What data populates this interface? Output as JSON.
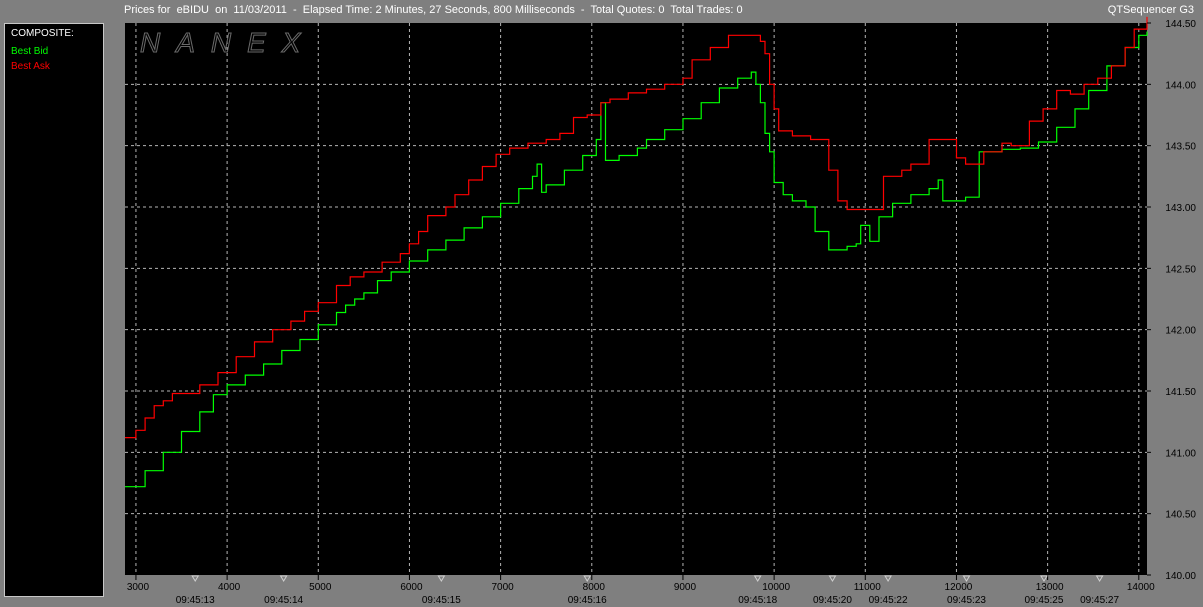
{
  "header": {
    "title": "Prices for  eBIDU  on  11/03/2011  -  Elapsed Time: 2 Minutes, 27 Seconds, 800 Milliseconds  -  Total Quotes: 0  Total Trades: 0",
    "app_name": "QTSequencer G3"
  },
  "legend": {
    "header": "COMPOSITE:",
    "items": [
      {
        "label": "Best Bid",
        "color": "#00ff00"
      },
      {
        "label": "Best Ask",
        "color": "#ff0000"
      }
    ]
  },
  "watermark": "NANEX",
  "colors": {
    "background": "#000000",
    "grid": "#b4b4b4",
    "frame": "#7f7f7f",
    "bid": "#00ff00",
    "ask": "#ff0000"
  },
  "chart_data": {
    "type": "line",
    "xlim": [
      2880,
      14090
    ],
    "ylim": [
      140.0,
      144.5
    ],
    "x_ticks": [
      3000,
      4000,
      5000,
      6000,
      7000,
      8000,
      9000,
      10000,
      11000,
      12000,
      13000,
      14000
    ],
    "x_tick_labels": [
      "3000",
      "4000",
      "5000",
      "6000",
      "7000",
      "8000",
      "9000",
      "10000",
      "11000",
      "12000",
      "13000",
      "14000"
    ],
    "y_ticks": [
      140.0,
      140.5,
      141.0,
      141.5,
      142.0,
      142.5,
      143.0,
      143.5,
      144.0,
      144.5
    ],
    "y_tick_labels": [
      "140.00",
      "140.50",
      "141.00",
      "141.50",
      "142.00",
      "142.50",
      "143.00",
      "143.50",
      "144.00",
      "144.50"
    ],
    "time_labels": [
      {
        "x": 3650,
        "label": "09:45:13"
      },
      {
        "x": 4620,
        "label": "09:45:14"
      },
      {
        "x": 6350,
        "label": "09:45:15"
      },
      {
        "x": 7950,
        "label": "09:45:16"
      },
      {
        "x": 9820,
        "label": "09:45:18"
      },
      {
        "x": 10640,
        "label": "09:45:20"
      },
      {
        "x": 11250,
        "label": "09:45:22"
      },
      {
        "x": 12110,
        "label": "09:45:23"
      },
      {
        "x": 12960,
        "label": "09:45:25"
      },
      {
        "x": 13570,
        "label": "09:45:27"
      }
    ],
    "grid": true,
    "series": [
      {
        "name": "Best Bid",
        "color": "#00ff00",
        "points": [
          [
            2880,
            140.72
          ],
          [
            3100,
            140.85
          ],
          [
            3300,
            141.0
          ],
          [
            3500,
            141.17
          ],
          [
            3700,
            141.33
          ],
          [
            3850,
            141.47
          ],
          [
            4000,
            141.55
          ],
          [
            4200,
            141.63
          ],
          [
            4400,
            141.72
          ],
          [
            4600,
            141.83
          ],
          [
            4800,
            141.92
          ],
          [
            5000,
            142.04
          ],
          [
            5200,
            142.14
          ],
          [
            5300,
            142.2
          ],
          [
            5400,
            142.25
          ],
          [
            5500,
            142.3
          ],
          [
            5650,
            142.4
          ],
          [
            5800,
            142.47
          ],
          [
            6000,
            142.56
          ],
          [
            6200,
            142.65
          ],
          [
            6400,
            142.73
          ],
          [
            6600,
            142.83
          ],
          [
            6800,
            142.92
          ],
          [
            7000,
            143.03
          ],
          [
            7200,
            143.15
          ],
          [
            7350,
            143.25
          ],
          [
            7400,
            143.35
          ],
          [
            7450,
            143.12
          ],
          [
            7500,
            143.18
          ],
          [
            7700,
            143.3
          ],
          [
            7900,
            143.42
          ],
          [
            8050,
            143.55
          ],
          [
            8100,
            143.85
          ],
          [
            8150,
            143.38
          ],
          [
            8300,
            143.42
          ],
          [
            8500,
            143.48
          ],
          [
            8600,
            143.55
          ],
          [
            8800,
            143.63
          ],
          [
            9000,
            143.72
          ],
          [
            9200,
            143.85
          ],
          [
            9400,
            143.97
          ],
          [
            9600,
            144.05
          ],
          [
            9750,
            144.1
          ],
          [
            9800,
            144.0
          ],
          [
            9850,
            143.85
          ],
          [
            9900,
            143.6
          ],
          [
            9950,
            143.45
          ],
          [
            10000,
            143.2
          ],
          [
            10100,
            143.1
          ],
          [
            10200,
            143.05
          ],
          [
            10350,
            143.0
          ],
          [
            10450,
            142.8
          ],
          [
            10600,
            142.65
          ],
          [
            10800,
            142.68
          ],
          [
            10900,
            142.7
          ],
          [
            10950,
            142.85
          ],
          [
            11050,
            142.72
          ],
          [
            11150,
            142.92
          ],
          [
            11300,
            143.03
          ],
          [
            11500,
            143.1
          ],
          [
            11700,
            143.15
          ],
          [
            11800,
            143.22
          ],
          [
            11850,
            143.05
          ],
          [
            12100,
            143.08
          ],
          [
            12250,
            143.45
          ],
          [
            12500,
            143.47
          ],
          [
            12700,
            143.48
          ],
          [
            12900,
            143.53
          ],
          [
            13100,
            143.65
          ],
          [
            13300,
            143.8
          ],
          [
            13450,
            143.95
          ],
          [
            13650,
            144.15
          ],
          [
            13850,
            144.3
          ],
          [
            14000,
            144.4
          ],
          [
            14090,
            144.43
          ]
        ]
      },
      {
        "name": "Best Ask",
        "color": "#ff0000",
        "points": [
          [
            2880,
            141.12
          ],
          [
            3000,
            141.18
          ],
          [
            3100,
            141.28
          ],
          [
            3200,
            141.38
          ],
          [
            3300,
            141.42
          ],
          [
            3400,
            141.48
          ],
          [
            3550,
            141.48
          ],
          [
            3700,
            141.55
          ],
          [
            3900,
            141.65
          ],
          [
            4100,
            141.78
          ],
          [
            4300,
            141.9
          ],
          [
            4500,
            142.0
          ],
          [
            4700,
            142.07
          ],
          [
            4850,
            142.15
          ],
          [
            5000,
            142.22
          ],
          [
            5200,
            142.36
          ],
          [
            5350,
            142.43
          ],
          [
            5500,
            142.47
          ],
          [
            5700,
            142.55
          ],
          [
            5900,
            142.62
          ],
          [
            6000,
            142.7
          ],
          [
            6100,
            142.8
          ],
          [
            6200,
            142.93
          ],
          [
            6400,
            143.0
          ],
          [
            6500,
            143.1
          ],
          [
            6650,
            143.22
          ],
          [
            6800,
            143.33
          ],
          [
            6950,
            143.43
          ],
          [
            7100,
            143.48
          ],
          [
            7300,
            143.52
          ],
          [
            7500,
            143.55
          ],
          [
            7650,
            143.6
          ],
          [
            7800,
            143.73
          ],
          [
            7950,
            143.75
          ],
          [
            8100,
            143.85
          ],
          [
            8200,
            143.88
          ],
          [
            8400,
            143.93
          ],
          [
            8600,
            143.96
          ],
          [
            8800,
            144.0
          ],
          [
            9000,
            144.05
          ],
          [
            9100,
            144.2
          ],
          [
            9300,
            144.3
          ],
          [
            9500,
            144.4
          ],
          [
            9700,
            144.4
          ],
          [
            9850,
            144.35
          ],
          [
            9900,
            144.25
          ],
          [
            9950,
            144.0
          ],
          [
            10000,
            143.8
          ],
          [
            10050,
            143.62
          ],
          [
            10200,
            143.58
          ],
          [
            10400,
            143.55
          ],
          [
            10600,
            143.3
          ],
          [
            10700,
            143.05
          ],
          [
            10800,
            142.98
          ],
          [
            11000,
            142.98
          ],
          [
            11200,
            143.25
          ],
          [
            11400,
            143.3
          ],
          [
            11500,
            143.35
          ],
          [
            11700,
            143.55
          ],
          [
            11900,
            143.55
          ],
          [
            12000,
            143.4
          ],
          [
            12100,
            143.35
          ],
          [
            12300,
            143.45
          ],
          [
            12500,
            143.52
          ],
          [
            12600,
            143.5
          ],
          [
            12800,
            143.7
          ],
          [
            12950,
            143.8
          ],
          [
            13100,
            143.95
          ],
          [
            13250,
            143.92
          ],
          [
            13400,
            144.0
          ],
          [
            13550,
            144.05
          ],
          [
            13700,
            144.15
          ],
          [
            13850,
            144.3
          ],
          [
            13950,
            144.45
          ],
          [
            14090,
            144.55
          ]
        ]
      }
    ]
  }
}
